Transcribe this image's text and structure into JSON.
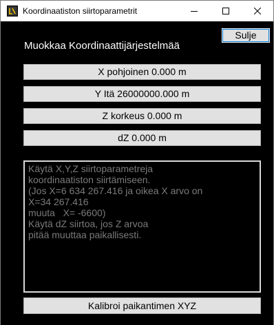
{
  "window": {
    "title": "Koordinaatiston siirtoparametrit",
    "app_icon": "app-icon"
  },
  "toolbar": {
    "close_label": "Sulje"
  },
  "main": {
    "heading": "Muokkaa Koordinaattijärjestelmää",
    "fields": [
      {
        "label": "X pohjoinen 0.000 m"
      },
      {
        "label": "Y Itä 26000000.000 m"
      },
      {
        "label": "Z korkeus 0.000 m"
      },
      {
        "label": "dZ 0.000 m"
      }
    ],
    "info_lines": [
      "Käytä X,Y,Z siirtoparametreja",
      "koordinaatiston siirtämiseen.",
      "(Jos X=6 634 267.416 ja oikea X arvo on",
      "X=34 267.416",
      "muuta   X= -6600)",
      "Käytä dZ siirtoa, jos Z arvoa",
      "pitää muuttaa paikallisesti."
    ],
    "calibrate_label": "Kalibroi paikantimen XYZ"
  }
}
